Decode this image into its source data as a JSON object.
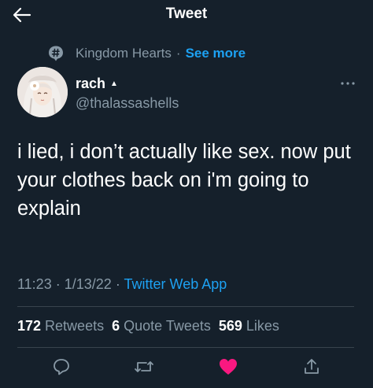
{
  "header": {
    "title": "Tweet",
    "back_icon": "back-arrow-icon"
  },
  "topic": {
    "icon": "topic-icon",
    "name": "Kingdom Hearts",
    "separator": "·",
    "link": "See more"
  },
  "author": {
    "display_name": "rach",
    "handle": "@thalassashells",
    "avatar_icon": "avatar"
  },
  "tweet": {
    "text": "i lied, i don’t actually like sex. now put your clothes back on i'm going to explain"
  },
  "meta": {
    "time": "11:23",
    "date": "1/13/22",
    "separator": "·",
    "source": "Twitter Web App"
  },
  "stats": {
    "retweets_count": "172",
    "retweets_label": "Retweets",
    "quotes_count": "6",
    "quotes_label": "Quote Tweets",
    "likes_count": "569",
    "likes_label": "Likes"
  },
  "actions": {
    "reply_icon": "reply-icon",
    "retweet_icon": "retweet-icon",
    "like_icon": "heart-icon",
    "share_icon": "share-icon"
  },
  "colors": {
    "background": "#15202b",
    "accent": "#1da1f2",
    "secondary_text": "#8899a6",
    "like": "#f91880",
    "divider": "#38444d"
  }
}
